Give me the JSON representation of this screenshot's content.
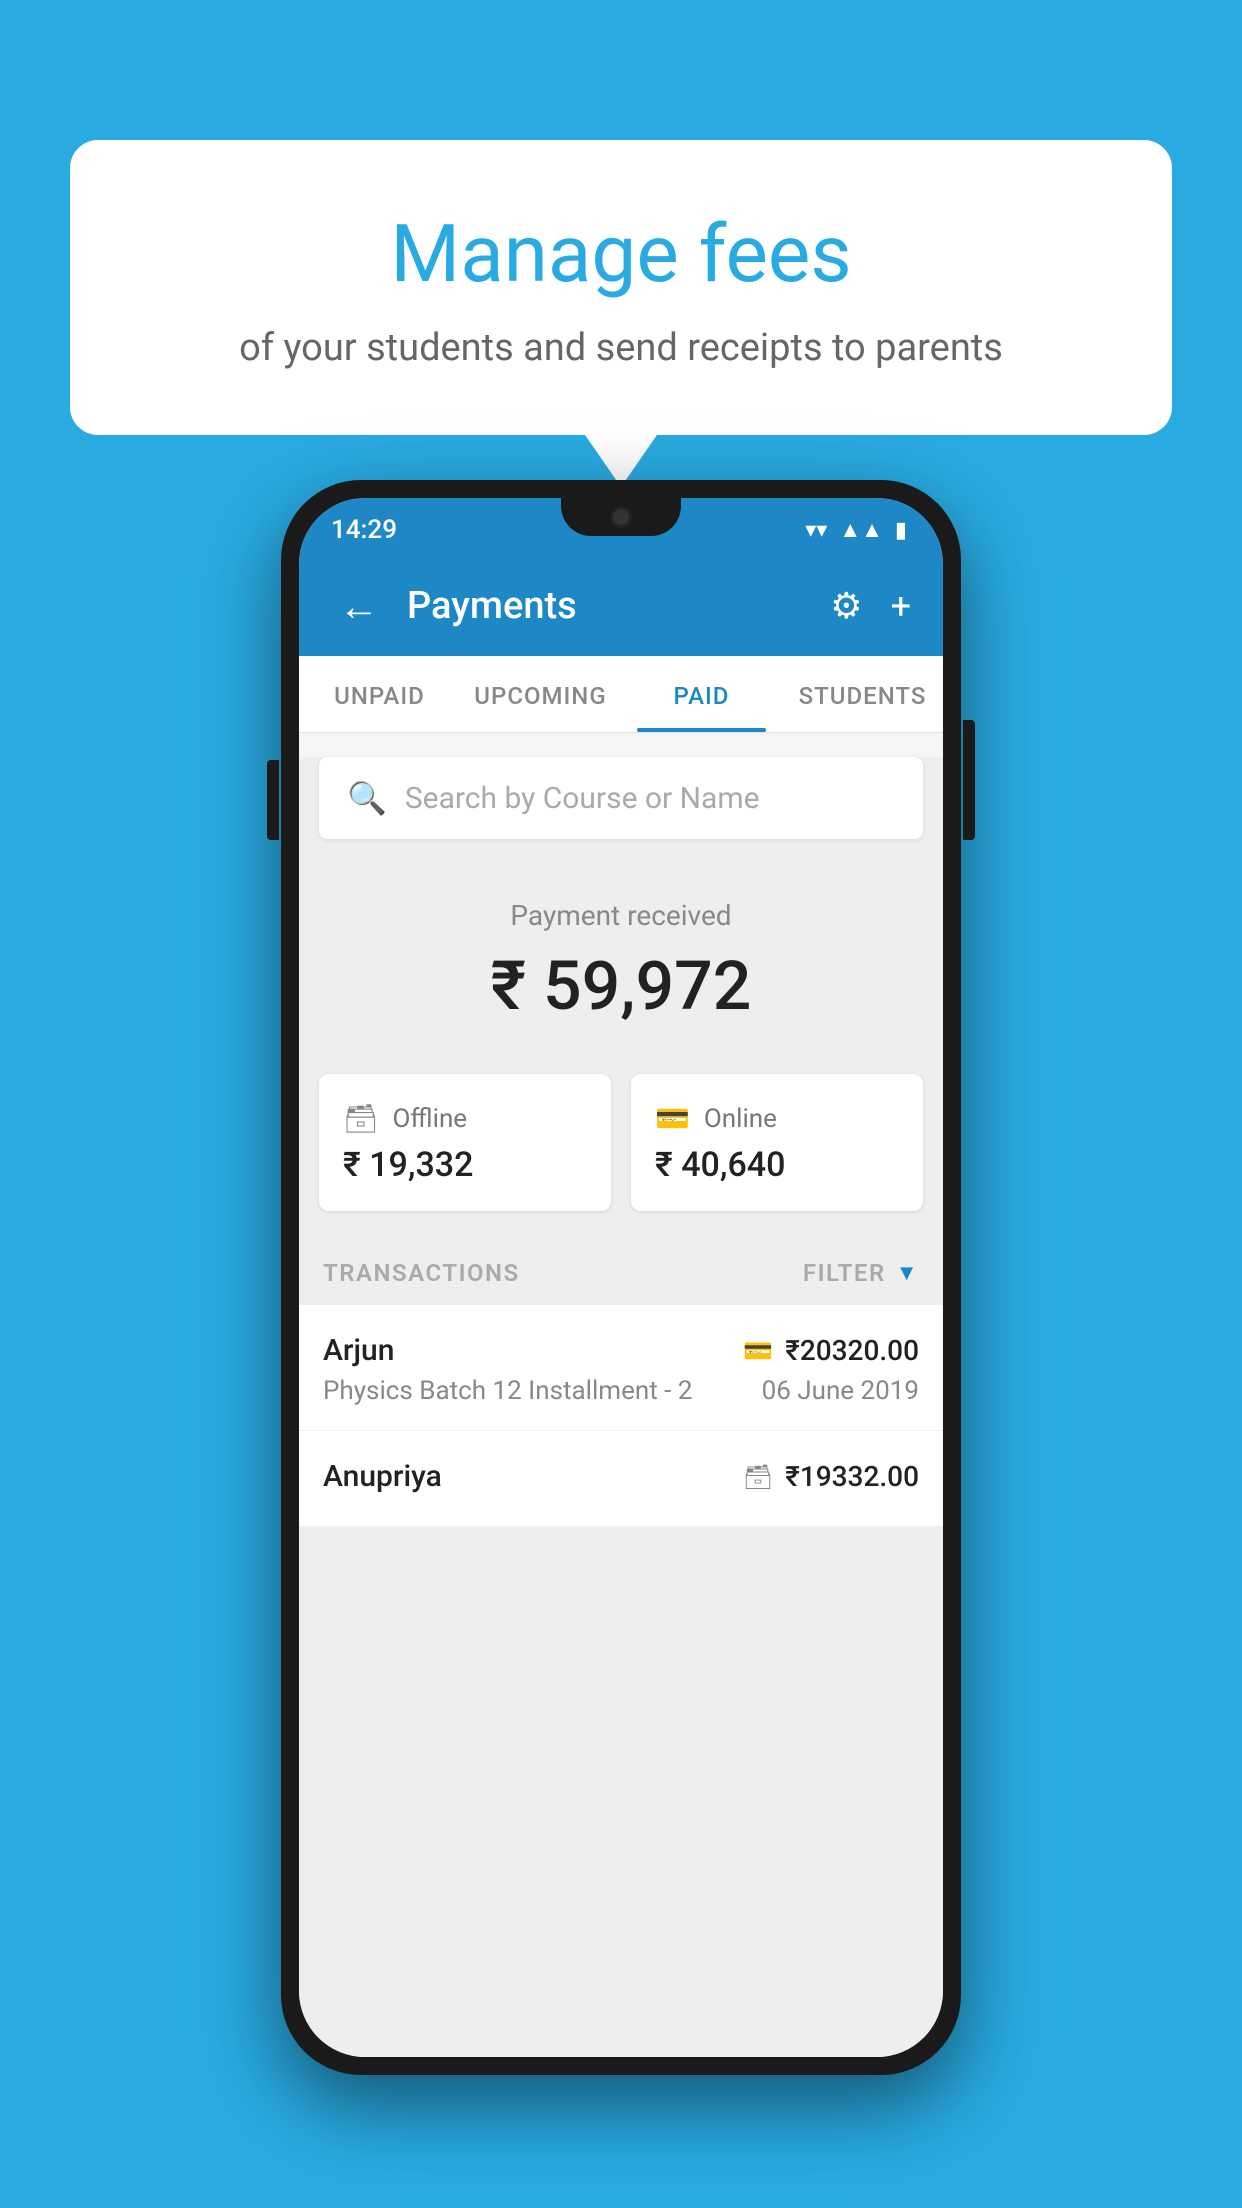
{
  "background_color": "#29abe2",
  "speech_bubble": {
    "title": "Manage fees",
    "subtitle": "of your students and send receipts to parents"
  },
  "status_bar": {
    "time": "14:29",
    "wifi": "▼",
    "signal": "▲",
    "battery": "▮"
  },
  "app_bar": {
    "title": "Payments",
    "back_label": "←",
    "settings_label": "⚙",
    "add_label": "+"
  },
  "tabs": [
    {
      "label": "UNPAID",
      "active": false
    },
    {
      "label": "UPCOMING",
      "active": false
    },
    {
      "label": "PAID",
      "active": true
    },
    {
      "label": "STUDENTS",
      "active": false
    }
  ],
  "search": {
    "placeholder": "Search by Course or Name"
  },
  "payment_received": {
    "label": "Payment received",
    "amount": "₹ 59,972"
  },
  "payment_cards": [
    {
      "type": "Offline",
      "amount": "₹ 19,332",
      "icon": "💳"
    },
    {
      "type": "Online",
      "amount": "₹ 40,640",
      "icon": "💳"
    }
  ],
  "transactions_section": {
    "label": "TRANSACTIONS",
    "filter_label": "FILTER"
  },
  "transactions": [
    {
      "name": "Arjun",
      "course": "Physics Batch 12 Installment - 2",
      "amount": "₹20320.00",
      "date": "06 June 2019",
      "payment_type": "online"
    },
    {
      "name": "Anupriya",
      "course": "",
      "amount": "₹19332.00",
      "date": "",
      "payment_type": "offline"
    }
  ]
}
